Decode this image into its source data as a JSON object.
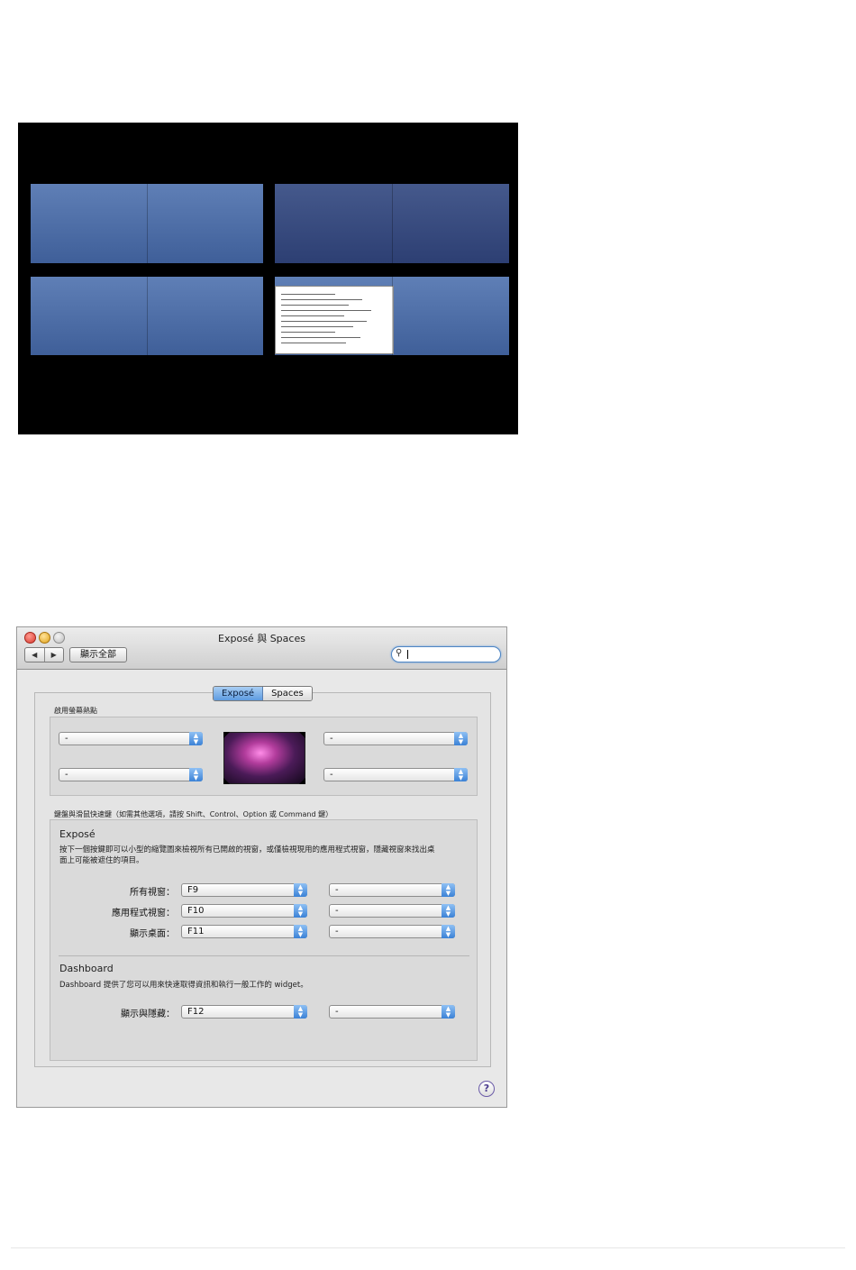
{
  "window": {
    "title": "Exposé 與 Spaces",
    "nav_back": "◀",
    "nav_forward": "▶",
    "show_all": "顯示全部",
    "search_value": ""
  },
  "tabs": [
    {
      "label": "Exposé",
      "active": true
    },
    {
      "label": "Spaces",
      "active": false
    }
  ],
  "hot_corners": {
    "section_label": "啟用螢幕熱點",
    "top_left": "-",
    "top_right": "-",
    "bottom_left": "-",
    "bottom_right": "-"
  },
  "shortcuts": {
    "section_label": "鍵盤與滑鼠快速鍵（如需其他選項，請按 Shift、Control、Option 或 Command 鍵）",
    "expose": {
      "heading": "Exposé",
      "description_line1": "按下一個按鍵即可以小型的縮覽圖來檢視所有已開啟的視窗，或僅檢視現用的應用程式視窗，隱藏視窗來找出桌",
      "description_line2": "面上可能被遮住的項目。",
      "rows": [
        {
          "label": "所有視窗：",
          "key": "F9",
          "mouse": "-"
        },
        {
          "label": "應用程式視窗：",
          "key": "F10",
          "mouse": "-"
        },
        {
          "label": "顯示桌面：",
          "key": "F11",
          "mouse": "-"
        }
      ]
    },
    "dashboard": {
      "heading": "Dashboard",
      "description": "Dashboard 提供了您可以用來快速取得資訊和執行一般工作的 widget。",
      "rows": [
        {
          "label": "顯示與隱藏：",
          "key": "F12",
          "mouse": "-"
        }
      ]
    }
  },
  "help_label": "?",
  "colors": {
    "accent_blue": "#3b82d6",
    "space_blue": "#4f6fa8",
    "spaces_background": "#000000"
  }
}
